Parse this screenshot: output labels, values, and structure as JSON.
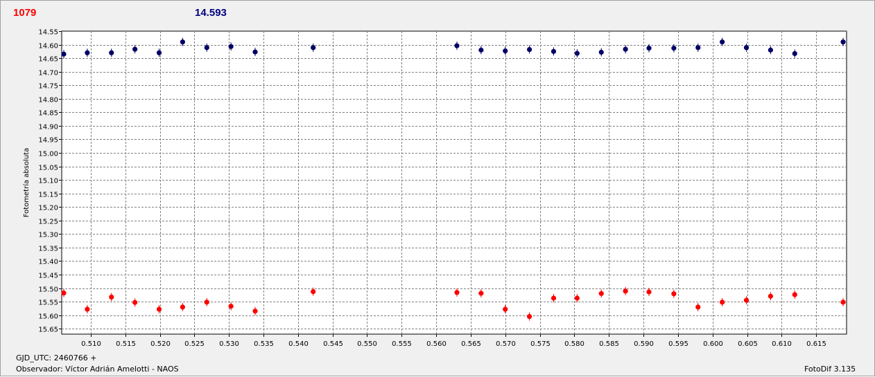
{
  "header": {
    "left_value": "1079",
    "right_value": "14.593"
  },
  "footer": {
    "gjd": "GJD_UTC: 2460766 +",
    "observer": "Observador: Víctor Adrián Amelotti - NAOS",
    "version": "FotoDif 3.135"
  },
  "colors": {
    "series_target": "#000066",
    "series_comparison": "#ff0000",
    "grid": "#808080"
  },
  "chart_data": {
    "type": "scatter",
    "title": "",
    "xlabel": "",
    "ylabel": "Fotometría absoluta",
    "xlim": [
      0.5058,
      0.6194
    ],
    "ylim": [
      14.55,
      15.67
    ],
    "y_inverted": true,
    "grid": true,
    "x_ticks": [
      0.51,
      0.515,
      0.52,
      0.525,
      0.53,
      0.535,
      0.54,
      0.545,
      0.55,
      0.555,
      0.56,
      0.565,
      0.57,
      0.575,
      0.58,
      0.585,
      0.59,
      0.595,
      0.6,
      0.605,
      0.61,
      0.615
    ],
    "x_tick_labels": [
      "0.510",
      "0.515",
      "0.520",
      "0.525",
      "0.530",
      "0.535",
      "0.540",
      "0.545",
      "0.550",
      "0.555",
      "0.560",
      "0.565",
      "0.570",
      "0.575",
      "0.580",
      "0.585",
      "0.590",
      "0.595",
      "0.600",
      "0.605",
      "0.610",
      "0.615"
    ],
    "y_ticks": [
      14.55,
      14.6,
      14.65,
      14.7,
      14.75,
      14.8,
      14.85,
      14.9,
      14.95,
      15.0,
      15.05,
      15.1,
      15.15,
      15.2,
      15.25,
      15.3,
      15.35,
      15.4,
      15.45,
      15.5,
      15.55,
      15.6,
      15.65
    ],
    "y_tick_labels": [
      "14.55",
      "14.60",
      "14.65",
      "14.70",
      "14.75",
      "14.80",
      "14.85",
      "14.90",
      "14.95",
      "15.00",
      "15.05",
      "15.10",
      "15.15",
      "15.20",
      "15.25",
      "15.30",
      "15.35",
      "15.40",
      "15.45",
      "15.50",
      "15.55",
      "15.60",
      "15.65"
    ],
    "series": [
      {
        "color": "#000066",
        "x": [
          0.5061,
          0.5095,
          0.513,
          0.5164,
          0.5199,
          0.5233,
          0.5268,
          0.5303,
          0.5338,
          0.5422,
          0.563,
          0.5665,
          0.57,
          0.5735,
          0.577,
          0.5804,
          0.5839,
          0.5874,
          0.5908,
          0.5944,
          0.5979,
          0.6014,
          0.6049,
          0.6084,
          0.6119,
          0.6189
        ],
        "y": [
          14.635,
          14.63,
          14.63,
          14.617,
          14.63,
          14.59,
          14.611,
          14.607,
          14.627,
          14.611,
          14.604,
          14.62,
          14.623,
          14.618,
          14.625,
          14.632,
          14.628,
          14.617,
          14.613,
          14.613,
          14.611,
          14.59,
          14.611,
          14.62,
          14.633,
          14.59
        ]
      },
      {
        "color": "#ff0000",
        "x": [
          0.5061,
          0.5095,
          0.513,
          0.5164,
          0.5199,
          0.5233,
          0.5268,
          0.5303,
          0.5338,
          0.5422,
          0.563,
          0.5665,
          0.57,
          0.5735,
          0.577,
          0.5804,
          0.5839,
          0.5874,
          0.5908,
          0.5944,
          0.5979,
          0.6014,
          0.6049,
          0.6084,
          0.6119,
          0.6189
        ],
        "y": [
          15.518,
          15.578,
          15.533,
          15.553,
          15.578,
          15.57,
          15.552,
          15.567,
          15.585,
          15.513,
          15.516,
          15.519,
          15.578,
          15.605,
          15.537,
          15.537,
          15.52,
          15.511,
          15.514,
          15.521,
          15.57,
          15.552,
          15.545,
          15.53,
          15.524,
          15.552
        ]
      }
    ]
  }
}
